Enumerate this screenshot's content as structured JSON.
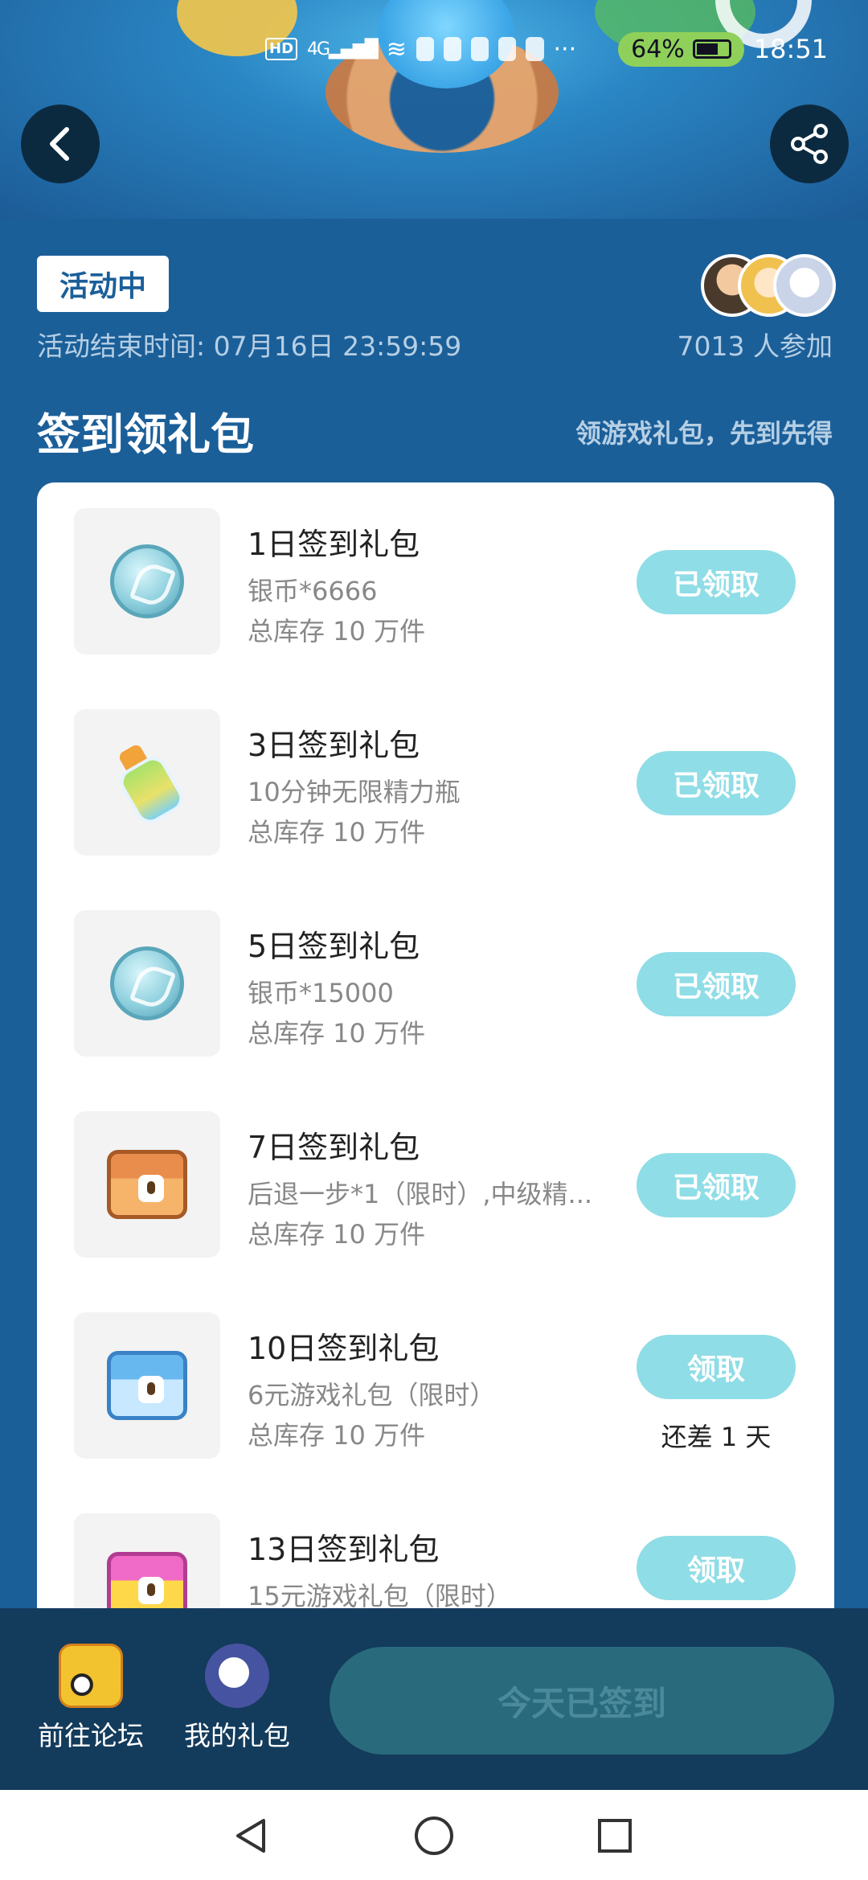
{
  "status_bar": {
    "network": "HD 4G",
    "battery": "64%",
    "time": "18:51"
  },
  "header": {
    "back_icon": "chevron-left-icon",
    "share_icon": "share-icon"
  },
  "activity": {
    "status": "活动中",
    "end_time": "活动结束时间: 07月16日 23:59:59",
    "participants": "7013 人参加"
  },
  "section": {
    "title": "签到领礼包",
    "subtitle": "领游戏礼包，先到先得"
  },
  "gifts": [
    {
      "title": "1日签到礼包",
      "desc": "银币*6666",
      "stock": "总库存 10 万件",
      "button": "已领取",
      "icon": "silver-coin-icon"
    },
    {
      "title": "3日签到礼包",
      "desc": "10分钟无限精力瓶",
      "stock": "总库存 10 万件",
      "button": "已领取",
      "icon": "energy-bottle-icon"
    },
    {
      "title": "5日签到礼包",
      "desc": "银币*15000",
      "stock": "总库存 10 万件",
      "button": "已领取",
      "icon": "silver-coin-icon"
    },
    {
      "title": "7日签到礼包",
      "desc": "后退一步*1（限时）,中级精...",
      "stock": "总库存 10 万件",
      "button": "已领取",
      "icon": "brown-chest-icon"
    },
    {
      "title": "10日签到礼包",
      "desc": "6元游戏礼包（限时）",
      "stock": "总库存 10 万件",
      "button": "领取",
      "note": "还差 1 天",
      "icon": "blue-chest-icon"
    },
    {
      "title": "13日签到礼包",
      "desc": "15元游戏礼包（限时）",
      "stock": "",
      "button": "领取",
      "icon": "pink-chest-icon"
    }
  ],
  "bottom": {
    "forum_label": "前往论坛",
    "mygift_label": "我的礼包",
    "signed_label": "今天已签到"
  },
  "colors": {
    "background": "#1b5f99",
    "button_disabled": "#8fdde6",
    "bottom_bar": "#133b5c"
  }
}
